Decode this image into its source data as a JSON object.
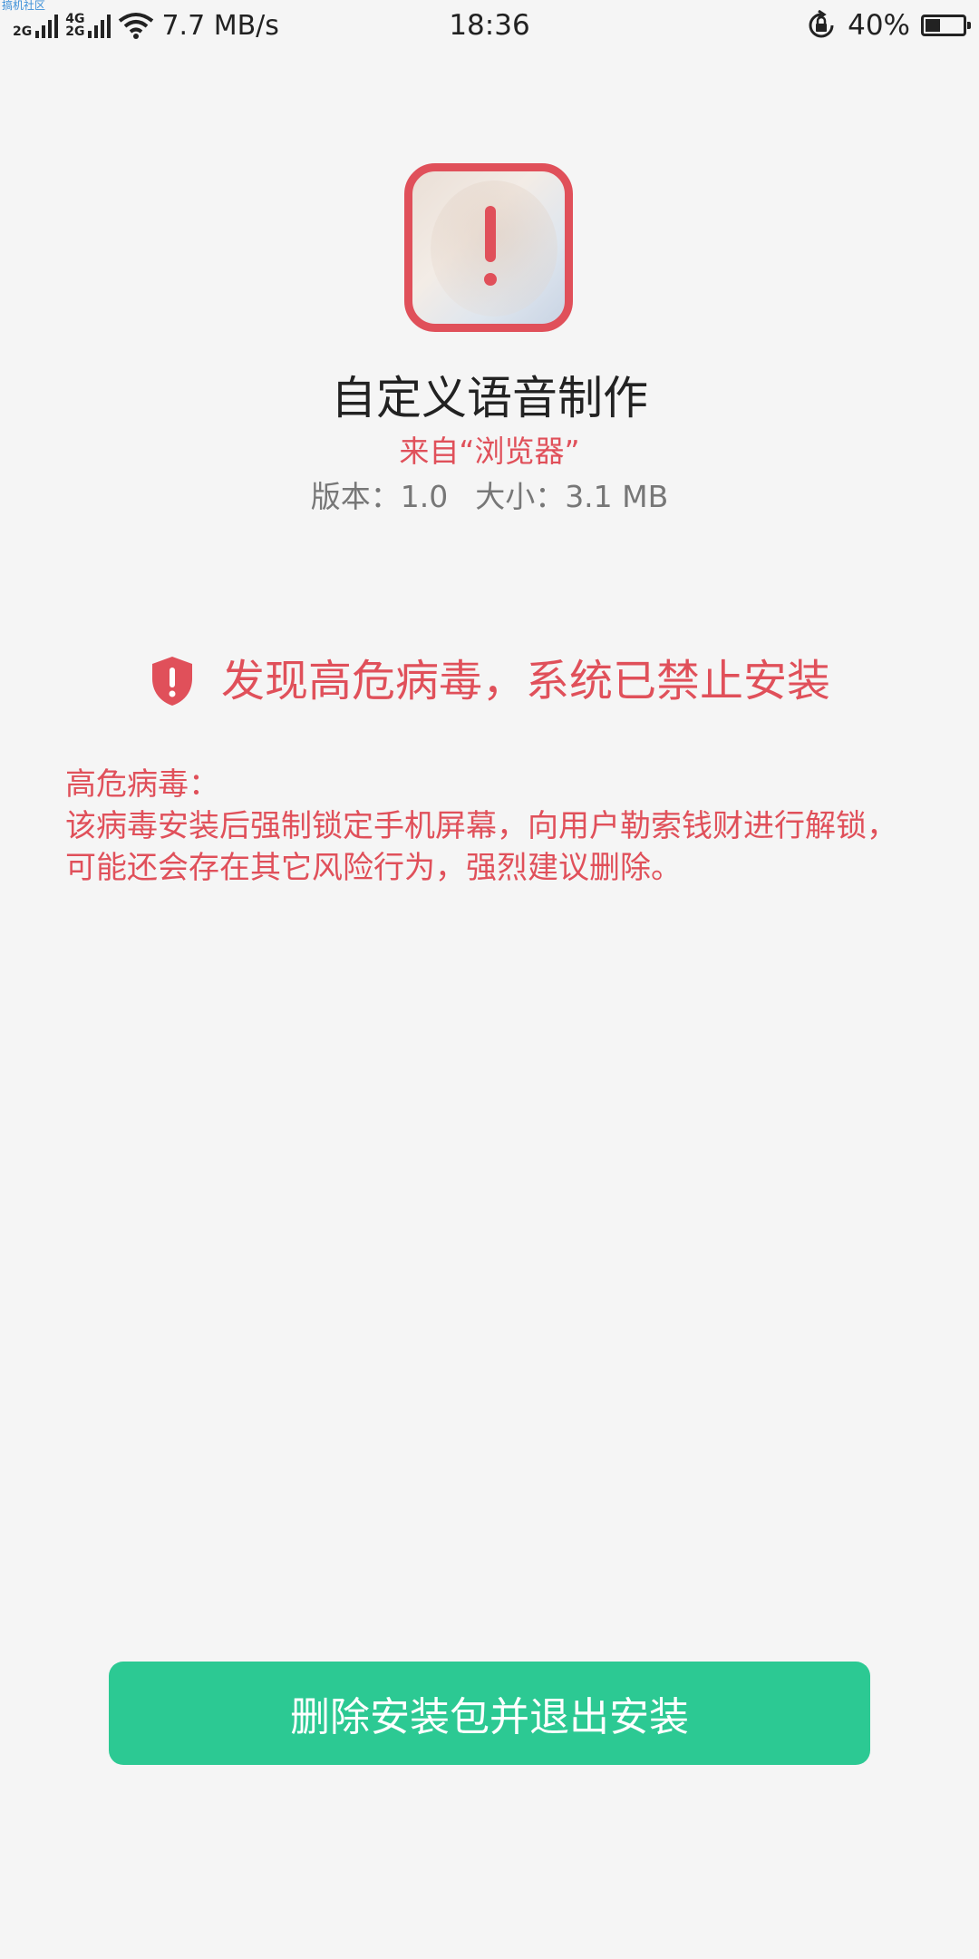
{
  "status_bar": {
    "watermark": "搞机社区",
    "network_1": "2G",
    "network_2a": "4G",
    "network_2b": "2G",
    "speed": "7.7 MB/s",
    "time": "18:36",
    "battery_percent": "40%",
    "battery_level": 0.4
  },
  "app": {
    "name": "自定义语音制作",
    "source": "来自“浏览器”",
    "version": "版本：1.0",
    "size": "大小：3.1 MB"
  },
  "warning": {
    "title": "发现高危病毒，系统已禁止安装",
    "detail_label": "高危病毒：",
    "detail_text": "该病毒安装后强制锁定手机屏幕，向用户勒索钱财进行解锁，可能还会存在其它风险行为，强烈建议删除。",
    "accent_color": "#e0505a"
  },
  "actions": {
    "delete_exit_label": "删除安装包并退出安装",
    "button_color": "#2cc993"
  }
}
